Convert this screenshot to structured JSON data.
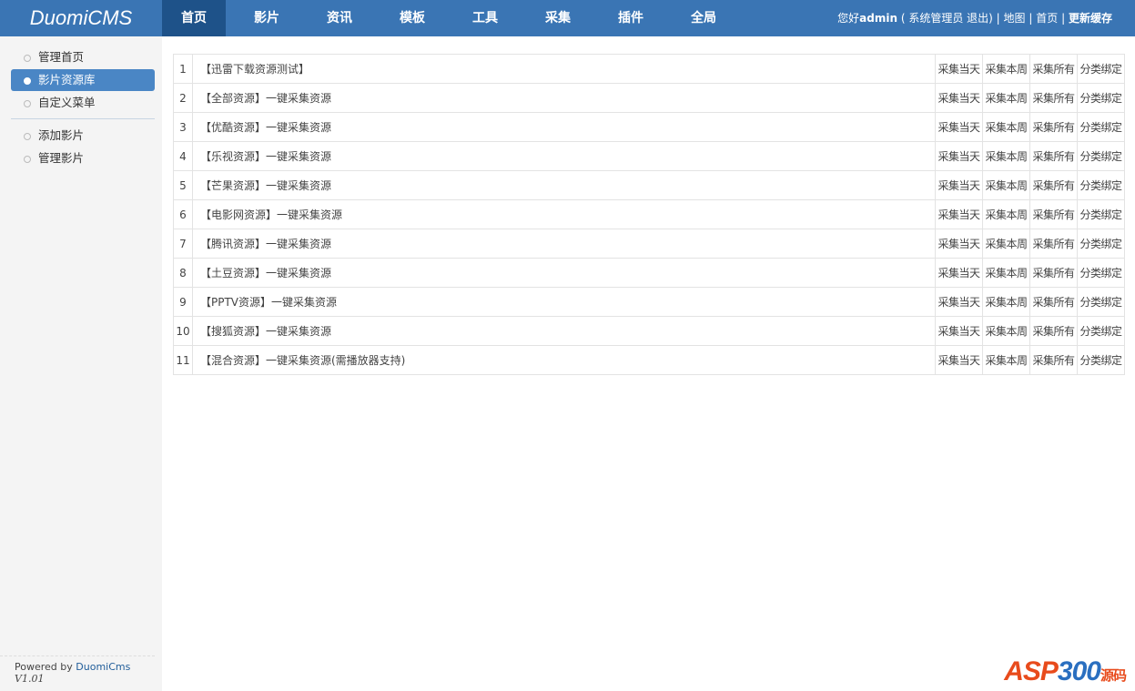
{
  "header": {
    "logo": "DuomiCMS",
    "tabs": [
      "首页",
      "影片",
      "资讯",
      "模板",
      "工具",
      "采集",
      "插件",
      "全局"
    ],
    "active_tab": 0,
    "greeting": "您好",
    "user": "admin",
    "role": "( 系统管理员",
    "logout": "退出)",
    "sep": "|",
    "map": "地图",
    "home": "首页",
    "refresh": "更新缓存"
  },
  "sidebar": {
    "items": [
      "管理首页",
      "影片资源库",
      "自定义菜单",
      "添加影片",
      "管理影片"
    ],
    "active": 1,
    "footer": {
      "prefix": "Powered by",
      "brand": "DuomiCms",
      "version": "V1.01"
    }
  },
  "table": {
    "actions": [
      "采集当天",
      "采集本周",
      "采集所有",
      "分类绑定"
    ],
    "rows": [
      {
        "n": "1",
        "name": "【迅雷下载资源测试】"
      },
      {
        "n": "2",
        "name": "【全部资源】一键采集资源"
      },
      {
        "n": "3",
        "name": "【优酷资源】一键采集资源"
      },
      {
        "n": "4",
        "name": "【乐视资源】一键采集资源"
      },
      {
        "n": "5",
        "name": "【芒果资源】一键采集资源"
      },
      {
        "n": "6",
        "name": "【电影网资源】一键采集资源"
      },
      {
        "n": "7",
        "name": "【腾讯资源】一键采集资源"
      },
      {
        "n": "8",
        "name": "【土豆资源】一键采集资源"
      },
      {
        "n": "9",
        "name": "【PPTV资源】一键采集资源"
      },
      {
        "n": "10",
        "name": "【搜狐资源】一键采集资源"
      },
      {
        "n": "11",
        "name": "【混合资源】一键采集资源(需播放器支持)"
      }
    ]
  },
  "watermark": {
    "a": "ASP",
    "b": "300",
    "c": "源码"
  }
}
